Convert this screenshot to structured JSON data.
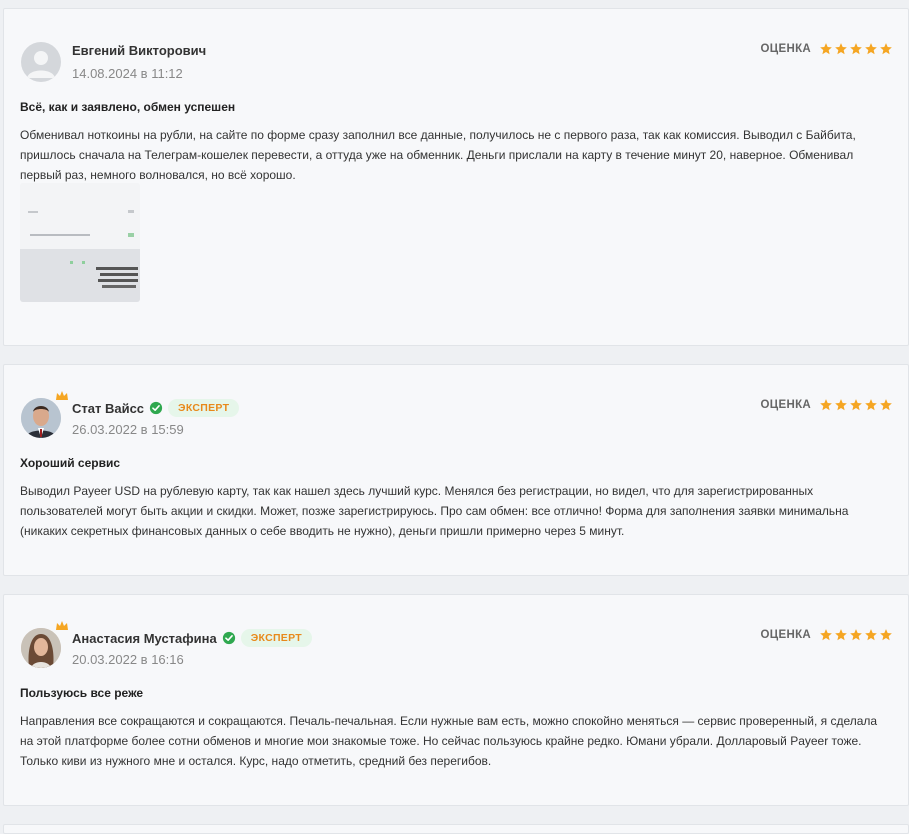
{
  "reviews": [
    {
      "author": "Евгений Викторович",
      "date": "14.08.2024 в 11:12",
      "rating_label": "ОЦЕНКА",
      "stars": 5,
      "title": "Всё, как и заявлено, обмен успешен",
      "text": "Обменивал ноткоины на рубли, на сайте по форме сразу заполнил все данные, получилось не с первого раза, так как комиссия. Выводил с Байбита, пришлось сначала на Телеграм-кошелек перевести, а оттуда уже на обменник. Деньги прислали на карту в течение минут 20, наверное. Обменивал первый раз, немного волновался, но всё хорошо.",
      "has_attachment": true
    },
    {
      "author": "Стат Вайсс",
      "badge": "ЭКСПЕРТ",
      "date": "26.03.2022 в 15:59",
      "rating_label": "ОЦЕНКА",
      "stars": 5,
      "title": "Хороший сервис",
      "text": "Выводил Payeer USD на рублевую карту, так как нашел здесь лучший курс. Менялся без регистрации, но видел, что для зарегистрированных пользователей могут быть акции и скидки. Может, позже зарегистрируюсь. Про сам обмен: все отлично! Форма для заполнения заявки минимальна (никаких секретных финансовых данных о себе вводить не нужно), деньги пришли примерно через 5 минут."
    },
    {
      "author": "Анастасия Мустафина",
      "badge": "ЭКСПЕРТ",
      "date": "20.03.2022 в 16:16",
      "rating_label": "ОЦЕНКА",
      "stars": 5,
      "title": "Пользуюсь все реже",
      "text": "Направления все сокращаются и сокращаются. Печаль-печальная. Если нужные вам есть, можно спокойно меняться — сервис проверенный, я сделала на этой платформе более сотни обменов и многие мои знакомые тоже. Но сейчас пользуюсь крайне редко. Юмани убрали. Долларовый Payeer тоже. Только киви из нужного мне и остался. Курс, надо отметить, средний без перегибов."
    }
  ],
  "colors": {
    "star": "#f5a623",
    "badge_text": "#e8891b",
    "badge_bg": "#e6f6ea",
    "verified": "#2fa84f"
  }
}
